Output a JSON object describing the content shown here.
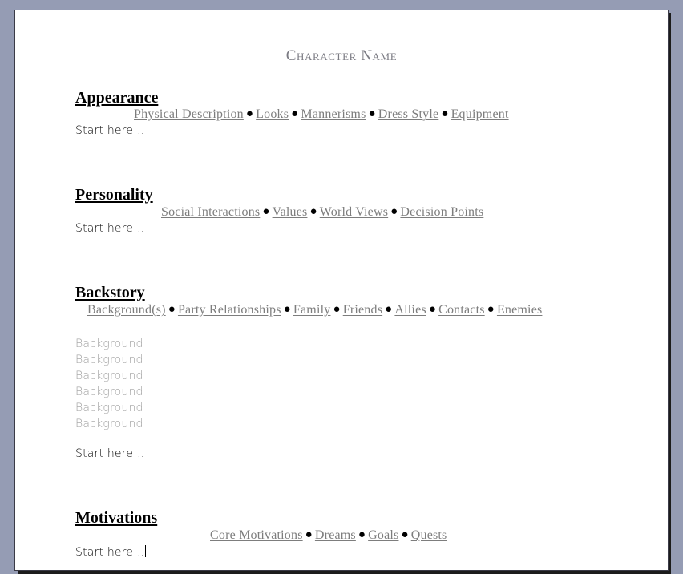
{
  "document": {
    "title": "Character Name",
    "background_color": "#959cb4",
    "page_color": "#ffffff",
    "heading_color": "#000000",
    "subtitle_color": "#7d7d7d",
    "placeholder_color": "#a0a0a0",
    "title_color": "#7b7b83"
  },
  "sections": [
    {
      "heading": "Appearance",
      "topics": [
        "Physical Description",
        "Looks",
        "Mannerisms",
        "Dress Style",
        "Equipment"
      ],
      "separator": "●",
      "body": "Start here…",
      "placeholders": [],
      "has_caret": false
    },
    {
      "heading": "Personality",
      "topics": [
        "Social Interactions",
        "Values",
        "World Views",
        "Decision Points"
      ],
      "separator": "●",
      "body": "Start here…",
      "placeholders": [],
      "has_caret": false
    },
    {
      "heading": "Backstory",
      "topics": [
        "Background(s)",
        "Party Relationships",
        "Family",
        "Friends",
        "Allies",
        "Contacts",
        "Enemies"
      ],
      "separator": "●",
      "body": "Start here…",
      "placeholders": [
        "Background",
        "Background",
        "Background",
        "Background",
        "Background",
        "Background"
      ],
      "has_caret": false
    },
    {
      "heading": "Motivations",
      "topics": [
        "Core Motivations",
        "Dreams",
        "Goals",
        "Quests"
      ],
      "separator": "●",
      "body": "Start here…",
      "placeholders": [],
      "has_caret": true
    }
  ]
}
